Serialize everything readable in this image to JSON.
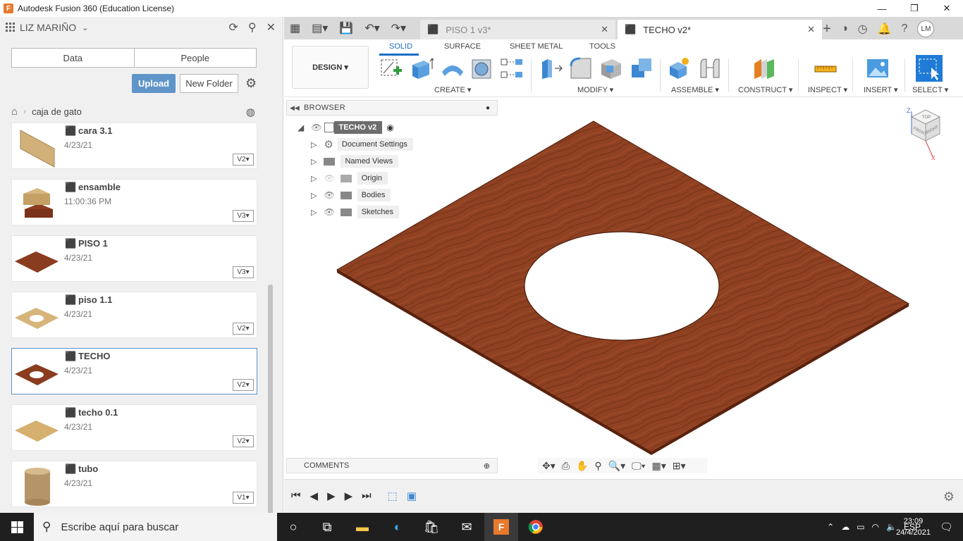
{
  "window": {
    "title": "Autodesk Fusion 360 (Education License)",
    "app_icon_letter": "F",
    "minimize": "—",
    "maximize": "❐",
    "close": "✕"
  },
  "data_panel": {
    "user": "LIZ MARIÑO",
    "tabs": [
      "Data",
      "People"
    ],
    "upload_label": "Upload",
    "new_folder_label": "New Folder",
    "breadcrumb": "caja de gato",
    "files": [
      {
        "name": "cara 3.1",
        "date": "4/23/21",
        "version": "V2"
      },
      {
        "name": "ensamble",
        "date": "11:00:36 PM",
        "version": "V3"
      },
      {
        "name": "PISO 1",
        "date": "4/23/21",
        "version": "V3"
      },
      {
        "name": "piso 1.1",
        "date": "4/23/21",
        "version": "V2"
      },
      {
        "name": "TECHO",
        "date": "4/23/21",
        "version": "V2"
      },
      {
        "name": "techo 0.1",
        "date": "4/23/21",
        "version": "V2"
      },
      {
        "name": "tubo",
        "date": "4/23/21",
        "version": "V1"
      }
    ]
  },
  "doc_tabs": [
    {
      "label": "PISO 1 v3*",
      "active": false
    },
    {
      "label": "TECHO v2*",
      "active": true
    }
  ],
  "avatar_initials": "LM",
  "toolbar": {
    "workspace": "DESIGN",
    "ribbon_tabs": [
      "SOLID",
      "SURFACE",
      "SHEET METAL",
      "TOOLS"
    ],
    "active_tab": "SOLID",
    "groups": [
      "CREATE",
      "MODIFY",
      "ASSEMBLE",
      "CONSTRUCT",
      "INSPECT",
      "INSERT",
      "SELECT"
    ]
  },
  "browser": {
    "title": "BROWSER",
    "root": "TECHO v2",
    "items": [
      "Document Settings",
      "Named Views",
      "Origin",
      "Bodies",
      "Sketches"
    ]
  },
  "comments": {
    "title": "COMMENTS"
  },
  "viewcube": {
    "top": "TOP",
    "front": "FRONT",
    "right": "RIGHT",
    "axis_z": "Z",
    "axis_x": "X"
  },
  "taskbar": {
    "search_placeholder": "Escribe aquí para buscar",
    "language": "ESP",
    "time": "23:09",
    "date": "24/4/2021"
  },
  "colors": {
    "accent": "#1a6fc4",
    "upload": "#5f95c8",
    "wood_dark": "#8a3c1f",
    "taskbar": "#1f1f1f"
  }
}
